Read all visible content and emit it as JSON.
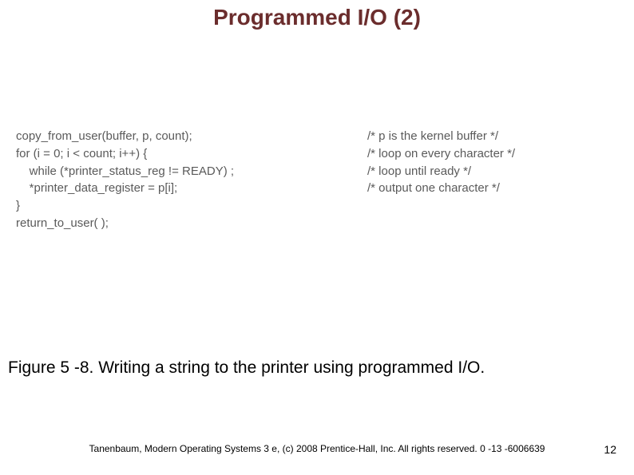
{
  "title": "Programmed I/O (2)",
  "code": {
    "rows": [
      {
        "left": "copy_from_user(buffer, p, count);",
        "right": "/* p is the kernel buffer */"
      },
      {
        "left": "for (i = 0; i < count; i++) {",
        "right": "/* loop on every character */"
      },
      {
        "left": "    while (*printer_status_reg != READY) ;",
        "right": "/* loop until ready */"
      },
      {
        "left": "    *printer_data_register = p[i];",
        "right": "/* output one character */"
      },
      {
        "left": "}",
        "right": ""
      },
      {
        "left": "return_to_user( );",
        "right": ""
      }
    ]
  },
  "caption": "Figure 5 -8. Writing a string to the printer using programmed I/O.",
  "footer": "Tanenbaum, Modern Operating Systems 3 e, (c) 2008 Prentice-Hall, Inc. All rights reserved. 0 -13 -6006639",
  "page_number": "12"
}
